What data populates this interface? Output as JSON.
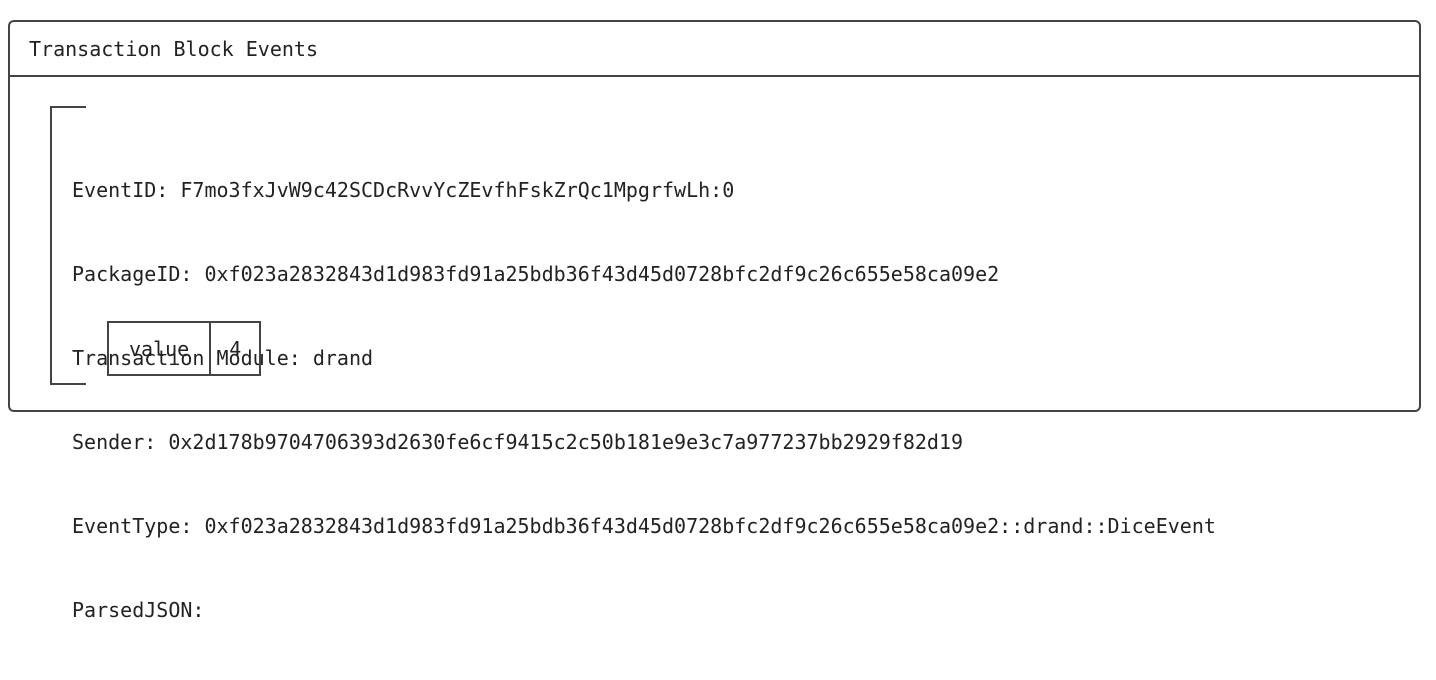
{
  "panel": {
    "title": "Transaction Block Events"
  },
  "event": {
    "event_id_label": "EventID: ",
    "event_id": "F7mo3fxJvW9c42SCDcRvvYcZEvfhFskZrQc1MpgrfwLh:0",
    "package_id_label": "PackageID: ",
    "package_id": "0xf023a2832843d1d983fd91a25bdb36f43d45d0728bfc2df9c26c655e58ca09e2",
    "module_label": "Transaction Module: ",
    "module": "drand",
    "sender_label": "Sender: ",
    "sender": "0x2d178b9704706393d2630fe6cf9415c2c50b181e9e3c7a977237bb2929f82d19",
    "event_type_label": "EventType: ",
    "event_type": "0xf023a2832843d1d983fd91a25bdb36f43d45d0728bfc2df9c26c655e58ca09e2::drand::DiceEvent",
    "parsed_json_label": "ParsedJSON:",
    "parsed_json": {
      "key": "value",
      "value": "4"
    }
  },
  "colors": {
    "border": "#444444",
    "text": "#222222",
    "background": "#ffffff"
  }
}
